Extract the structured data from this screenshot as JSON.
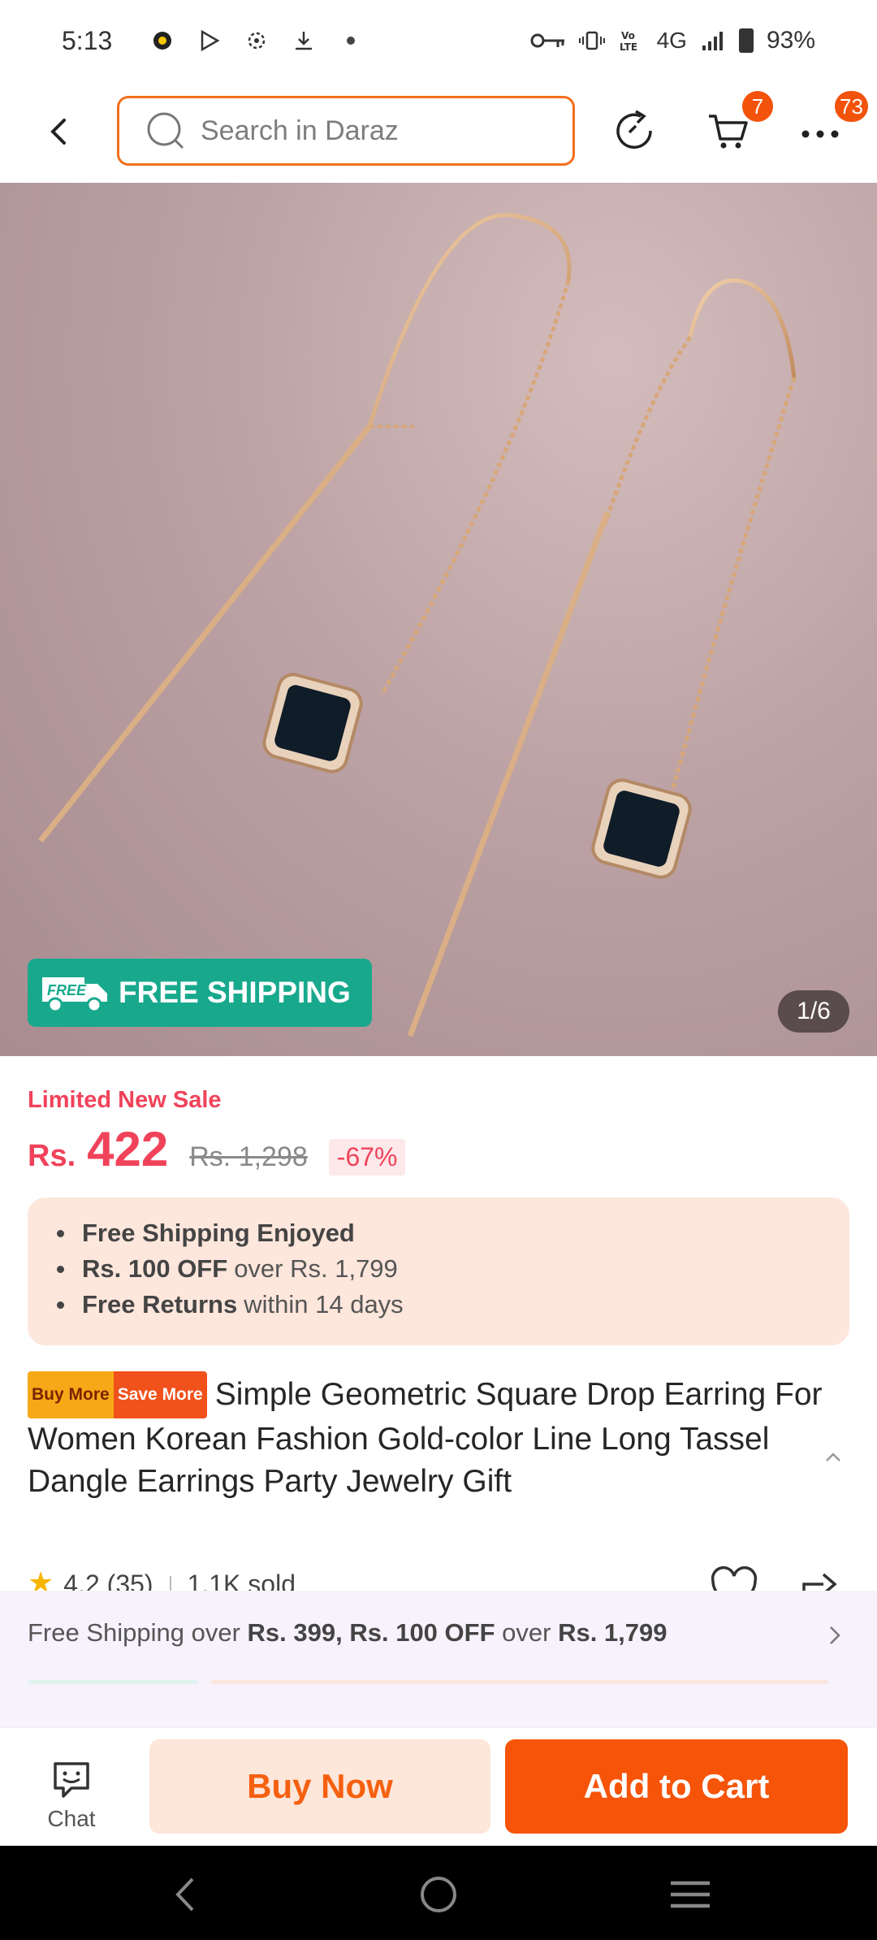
{
  "status_bar": {
    "time": "5:13",
    "network": "4G",
    "battery": "93%"
  },
  "header": {
    "search_placeholder": "Search in Daraz",
    "cart_badge": "7",
    "more_badge": "73"
  },
  "hero": {
    "free_shipping_label": "FREE SHIPPING",
    "free_badge_text": "FREE",
    "image_counter": "1/6"
  },
  "price": {
    "promo_label": "Limited New Sale",
    "currency": "Rs.",
    "current": "422",
    "original": "Rs. 1,298",
    "discount": "-67%"
  },
  "benefits": [
    {
      "bold": "Free Shipping Enjoyed",
      "rest": ""
    },
    {
      "bold": "Rs. 100 OFF",
      "rest": "over Rs. 1,799"
    },
    {
      "bold": "Free Returns",
      "rest": "within 14 days"
    }
  ],
  "product": {
    "tag_buy_more": "Buy More",
    "tag_save_more": "Save More",
    "title": "Simple Geometric Square Drop Earring For Women Korean Fashion Gold-color Line Long Tassel Dangle Earrings Party Jewelry Gift",
    "rating": "4.2 (35)",
    "sold": "1.1K sold"
  },
  "promo_strip": {
    "prefix": "Free Shipping over ",
    "bold1": "Rs. 399, Rs. 100 OFF",
    "middle": " over ",
    "bold2": "Rs. 1,799"
  },
  "actions": {
    "chat_label": "Chat",
    "buy_now": "Buy Now",
    "add_to_cart": "Add to Cart"
  },
  "colors": {
    "accent": "#f65409",
    "price": "#f0435a",
    "free_shipping": "#18a98d"
  }
}
